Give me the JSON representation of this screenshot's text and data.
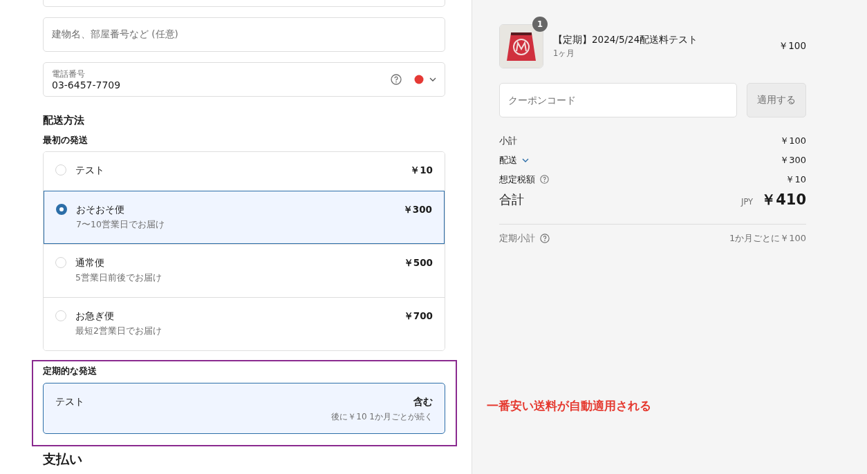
{
  "address_fields": [
    {
      "placeholder": "建物名、部屋番号など (任意)"
    }
  ],
  "phone_field": {
    "label": "電話番号",
    "value": "03-6457-7709"
  },
  "shipping": {
    "heading": "配送方法",
    "first_label": "最初の発送",
    "options": [
      {
        "name": "テスト",
        "price": "￥10",
        "selected": false
      },
      {
        "name": "おそおそ便",
        "note": "7〜10営業日でお届け",
        "price": "￥300",
        "selected": true
      },
      {
        "name": "通常便",
        "note": "5営業日前後でお届け",
        "price": "￥500",
        "selected": false
      },
      {
        "name": "お急ぎ便",
        "note": "最短2営業日でお届け",
        "price": "￥700",
        "selected": false
      }
    ],
    "recurring_label": "定期的な発送",
    "recurring": {
      "name": "テスト",
      "price": "含む",
      "note": "後に￥10 1か月ごとが続く"
    }
  },
  "payment_heading": "支払い",
  "annotation": "一番安い送料が自動適用される",
  "summary": {
    "item": {
      "quantity": "1",
      "title": "【定期】2024/5/24配送料テスト",
      "variant": "1ヶ月",
      "price": "￥100"
    },
    "coupon": {
      "placeholder": "クーポンコード",
      "button": "適用する"
    },
    "lines": [
      {
        "label": "小計",
        "value": "￥100",
        "kind": "plain"
      },
      {
        "label": "配送",
        "value": "￥300",
        "kind": "expand"
      },
      {
        "label": "想定税額",
        "value": "￥10",
        "kind": "help"
      }
    ],
    "total": {
      "label": "合計",
      "currency": "JPY",
      "value": "￥410"
    },
    "recurring": {
      "label": "定期小計",
      "value": "1か月ごとに￥100"
    }
  }
}
